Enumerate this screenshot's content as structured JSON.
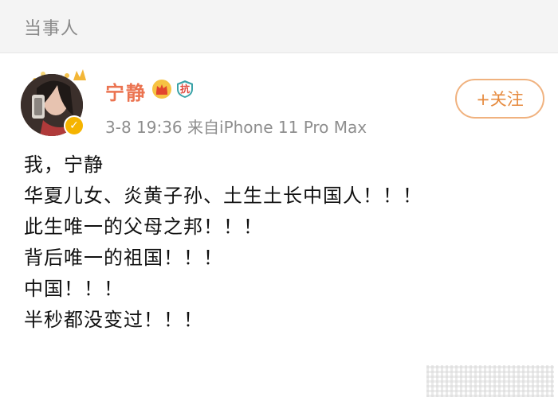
{
  "section": {
    "title": "当事人"
  },
  "post": {
    "username": "宁静",
    "badge_text": "抗",
    "meta": "3-8 19:36 来自iPhone 11 Pro Max",
    "follow_label": "+关注",
    "lines": [
      "我，宁静",
      "华夏儿女、炎黄子孙、土生土长中国人！！！",
      "此生唯一的父母之邦！！！",
      "背后唯一的祖国！！！",
      "中国！！！",
      "半秒都没变过！！！"
    ]
  },
  "colors": {
    "username": "#eb7350",
    "meta": "#8e8e8e",
    "follow_border": "#f0b27f",
    "follow_text": "#e68a3e",
    "verify": "#f5b400"
  },
  "icons": [
    "vip-crown-icon",
    "shield-badge-icon",
    "verified-icon"
  ]
}
